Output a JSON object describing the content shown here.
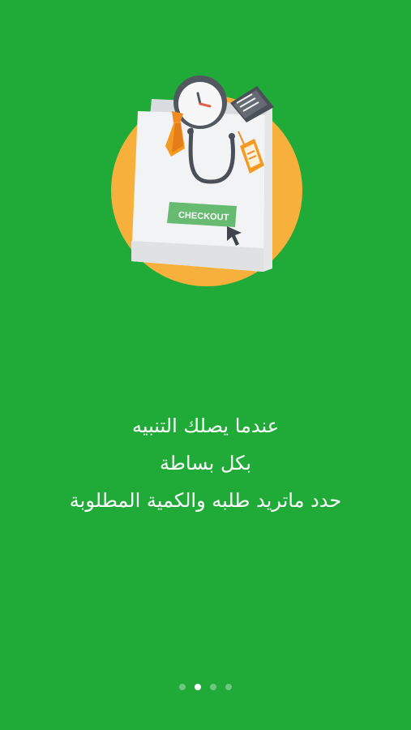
{
  "onboarding": {
    "illustration": {
      "icon": "shopping-bag-checkout-illustration",
      "checkout_label": "CHECKOUT",
      "colors": {
        "circle": "#f8b03d",
        "bag": "#f1f2f3",
        "checkout_button": "#66bb71"
      }
    },
    "message": {
      "lines": [
        "عندما يصلك التنبيه",
        "بكل بساطة",
        "حدد ماتريد طلبه والكمية المطلوبة"
      ]
    },
    "pager": {
      "total_pages": 4,
      "current_page": 2
    }
  },
  "theme": {
    "background": "#20ab39",
    "text": "#ffffff"
  }
}
